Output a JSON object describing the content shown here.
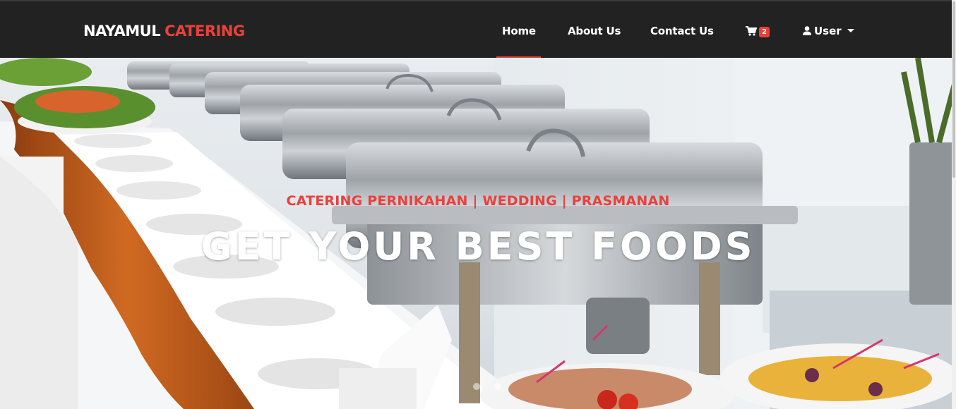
{
  "brand": {
    "part1": "NAYAMUL",
    "part2": "CATERING"
  },
  "nav": {
    "items": [
      {
        "label": "Home",
        "active": true
      },
      {
        "label": "About Us",
        "active": false
      },
      {
        "label": "Contact Us",
        "active": false
      }
    ],
    "cart": {
      "icon": "shopping-cart-icon",
      "count": "2"
    },
    "user": {
      "icon": "user-icon",
      "label": "User"
    }
  },
  "hero": {
    "subtitle": "CATERING PERNIKAHAN | WEDDING | PRASMANAN",
    "title": "GET YOUR BEST FOODS",
    "slides": 3,
    "active_slide": 1
  },
  "colors": {
    "navbar": "#222222",
    "accent": "#e8413d",
    "text": "#ffffff"
  }
}
